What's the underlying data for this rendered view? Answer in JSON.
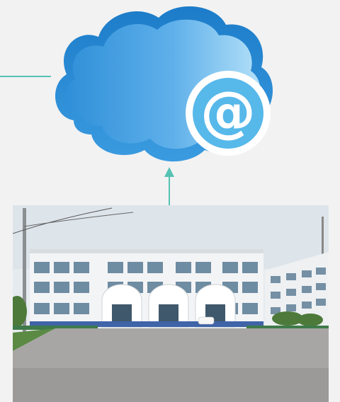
{
  "diagram": {
    "cloud_icon": "cloud-email-icon",
    "at_symbol": "@",
    "connector_color": "#56c2b4",
    "cloud_color_light": "#a9d9f5",
    "cloud_color_dark": "#2f8fd8"
  },
  "photo": {
    "subject": "school-building-photo"
  }
}
